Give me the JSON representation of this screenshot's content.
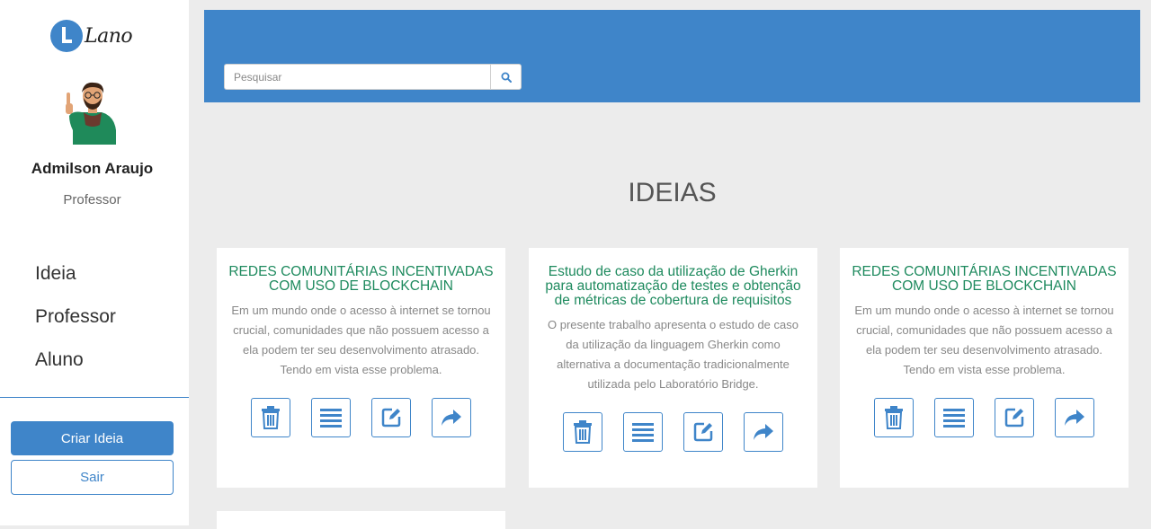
{
  "brand": {
    "logo_text": "Lano"
  },
  "user": {
    "name": "Admilson Araujo",
    "role": "Professor"
  },
  "nav": {
    "items": [
      {
        "label": "Ideia"
      },
      {
        "label": "Professor"
      },
      {
        "label": "Aluno"
      }
    ]
  },
  "actions": {
    "create_label": "Criar Ideia",
    "logout_label": "Sair"
  },
  "search": {
    "placeholder": "Pesquisar",
    "value": ""
  },
  "page": {
    "title": "IDEIAS"
  },
  "colors": {
    "primary": "#3f85c9",
    "card_title": "#1e8a5e",
    "background": "#ececec"
  },
  "cards": [
    {
      "title": "REDES COMUNITÁRIAS INCENTIVADAS COM USO DE BLOCKCHAIN",
      "description": "Em um mundo onde o acesso à internet se tornou crucial, comunidades que não possuem acesso a ela podem ter seu desenvolvimento atrasado. Tendo em vista esse problema."
    },
    {
      "title": "Estudo de caso da utilização de Gherkin para automatização de testes e obtenção de métricas de cobertura de requisitos",
      "description": "O presente trabalho apresenta o estudo de caso da utilização da linguagem Gherkin como alternativa a documentação tradicionalmente utilizada pelo Laboratório Bridge."
    },
    {
      "title": "REDES COMUNITÁRIAS INCENTIVADAS COM USO DE BLOCKCHAIN",
      "description": "Em um mundo onde o acesso à internet se tornou crucial, comunidades que não possuem acesso a ela podem ter seu desenvolvimento atrasado. Tendo em vista esse problema."
    }
  ],
  "card_action_icons": [
    "trash-icon",
    "list-icon",
    "edit-icon",
    "share-icon"
  ]
}
